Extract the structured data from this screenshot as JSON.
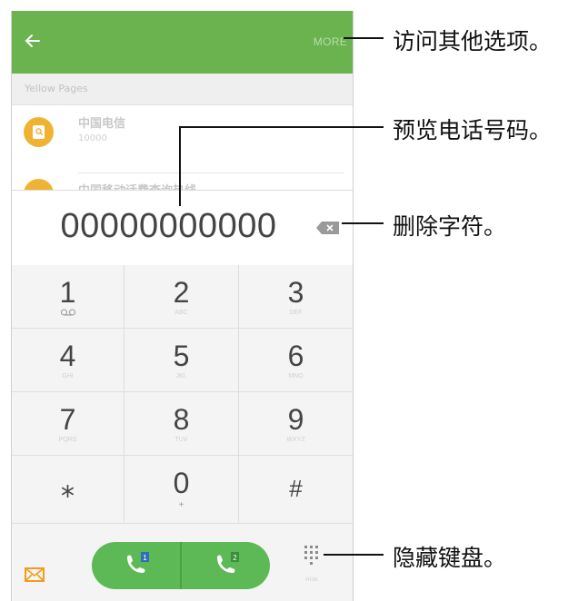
{
  "app_bar": {
    "more_label": "MORE"
  },
  "list": {
    "section_header": "Yellow Pages",
    "contacts": [
      {
        "name": "中国电信",
        "number": "10000"
      },
      {
        "name": "中国移动话费查询热线",
        "number": ""
      }
    ]
  },
  "display": {
    "number": "00000000000"
  },
  "keypad": {
    "keys": [
      {
        "digit": "1",
        "letters": ""
      },
      {
        "digit": "2",
        "letters": "ABC"
      },
      {
        "digit": "3",
        "letters": "DEF"
      },
      {
        "digit": "4",
        "letters": "GHI"
      },
      {
        "digit": "5",
        "letters": "JKL"
      },
      {
        "digit": "6",
        "letters": "MNO"
      },
      {
        "digit": "7",
        "letters": "PQRS"
      },
      {
        "digit": "8",
        "letters": "TUV"
      },
      {
        "digit": "9",
        "letters": "WXYZ"
      },
      {
        "digit": "⁎",
        "letters": ""
      },
      {
        "digit": "0",
        "letters": "+"
      },
      {
        "digit": "#",
        "letters": ""
      }
    ]
  },
  "bottom_bar": {
    "sim1_label": "1",
    "sim2_label": "2",
    "hide_keypad_label": "Hide"
  },
  "callouts": {
    "more_options": "访问其他选项。",
    "preview_number": "预览电话号码。",
    "delete_char": "删除字符。",
    "hide_keypad": "隐藏键盘。"
  },
  "colors": {
    "app_bar": "#6ab34e",
    "call_button": "#5db955",
    "contact_avatar": "#f0b233",
    "message_icon": "#f39c1c"
  }
}
